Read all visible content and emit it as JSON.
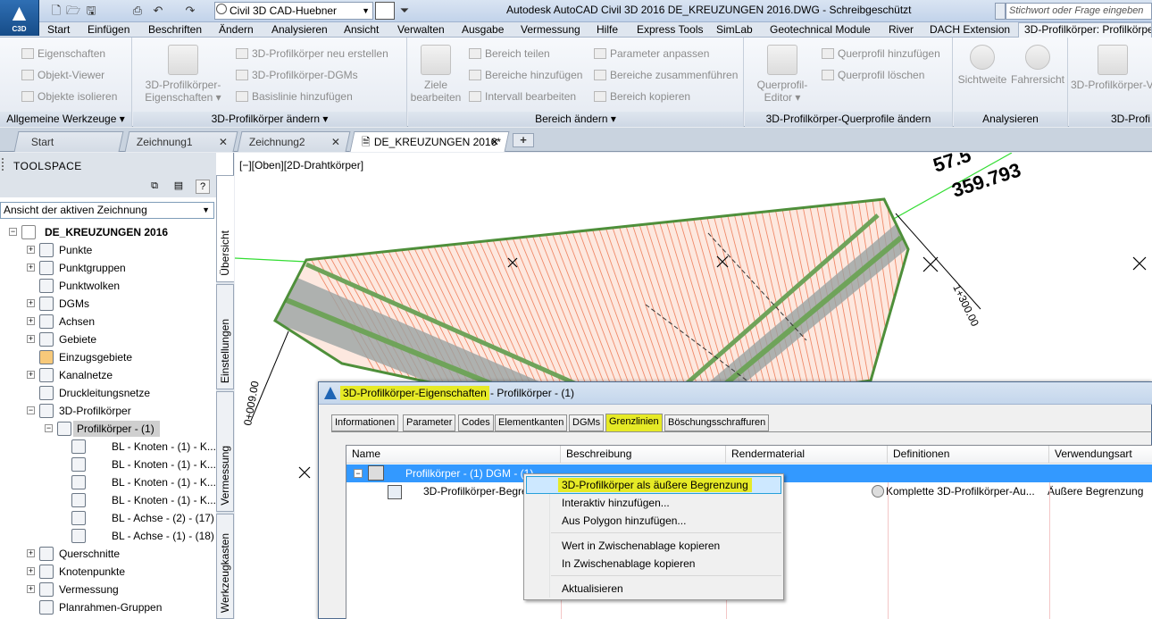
{
  "app": {
    "logo_text": "C3D",
    "workspace": "Civil 3D CAD-Huebner",
    "title": "Autodesk AutoCAD Civil 3D 2016   DE_KREUZUNGEN 2016.DWG - Schreibgeschützt",
    "search_placeholder": "Stichwort oder Frage eingeben"
  },
  "menu_tabs": [
    "Start",
    "Einfügen",
    "Beschriften",
    "Ändern",
    "Analysieren",
    "Ansicht",
    "Verwalten",
    "Ausgabe",
    "Vermessung",
    "Hilfe",
    "Express Tools",
    "SimLab",
    "Geotechnical Module",
    "River",
    "DACH Extension",
    "3D-Profilkörper: Profilkörper - (1)"
  ],
  "ribbon": {
    "panel1": {
      "title": "Allgemeine Werkzeuge",
      "items": [
        "Eigenschaften",
        "Objekt-Viewer",
        "Objekte isolieren"
      ]
    },
    "panel2": {
      "title": "3D-Profilkörper ändern",
      "big_line1": "3D-Profilkörper-",
      "big_line2": "Eigenschaften",
      "items": [
        "3D-Profilkörper neu erstellen",
        "3D-Profilkörper-DGMs",
        "Basislinie hinzufügen"
      ]
    },
    "panel3": {
      "title": "Bereich ändern",
      "big_line1": "Ziele",
      "big_line2": "bearbeiten",
      "items": [
        "Bereich teilen",
        "Bereiche hinzufügen",
        "Intervall bearbeiten",
        "Parameter anpassen",
        "Bereiche zusammenführen",
        "Bereich kopieren"
      ]
    },
    "panel4": {
      "title": "3D-Profilkörper-Querprofile ändern",
      "big_line1": "Querprofil-",
      "big_line2": "Editor",
      "items": [
        "Querprofil hinzufügen",
        "Querprofil löschen"
      ]
    },
    "panel5": {
      "title": "Analysieren",
      "big1": "Sichtweite",
      "big2": "Fahrersicht"
    },
    "panel6": {
      "title": "3D-Profi",
      "big1": "3D-Profilkörper-V"
    }
  },
  "doc_tabs": [
    "Start",
    "Zeichnung1",
    "Zeichnung2",
    "DE_KREUZUNGEN 2016*"
  ],
  "toolspace": {
    "title": "TOOLSPACE",
    "view_select": "Ansicht der aktiven Zeichnung",
    "drawing": "DE_KREUZUNGEN 2016",
    "tree": [
      "Punkte",
      "Punktgruppen",
      "Punktwolken",
      "DGMs",
      "Achsen",
      "Gebiete",
      "Einzugsgebiete",
      "Kanalnetze",
      "Druckleitungsnetze",
      "3D-Profilkörper"
    ],
    "corridor": "Profilkörper - (1)",
    "baselines": [
      "BL - Knoten - (1) - K...",
      "BL - Knoten - (1) - K...",
      "BL - Knoten - (1) - K...",
      "BL - Knoten - (1) - K...",
      "BL - Achse - (2) - (17)",
      "BL - Achse - (1) - (18)"
    ],
    "tree_after": [
      "Querschnitte",
      "Knotenpunkte",
      "Vermessung",
      "Planrahmen-Gruppen"
    ],
    "vtabs": [
      "Übersicht",
      "Einstellungen",
      "Vermessung",
      "Werkzeugkasten"
    ]
  },
  "viewport": {
    "label": "[−][Oben][2D-Drahtkörper]",
    "annotations": [
      "57.5",
      "359.793",
      "1+300.00",
      "0+009.00"
    ]
  },
  "dialog": {
    "title_hl": "3D-Profilkörper-Eigenschaften",
    "title_rest": " - Profilkörper - (1)",
    "tabs": [
      "Informationen",
      "Parameter",
      "Codes",
      "Elementkanten",
      "DGMs",
      "Grenzlinien",
      "Böschungsschraffuren"
    ],
    "columns": [
      "Name",
      "Beschreibung",
      "Rendermaterial",
      "Definitionen",
      "Verwendungsart"
    ],
    "row1_name": "Profilkörper - (1) DGM - (1)",
    "row2_name": "3D-Profilkörper-Begre",
    "row2_definition": "Komplette 3D-Profilkörper-Au...",
    "row2_usage": "Äußere Begrenzung"
  },
  "context_menu": [
    "3D-Profilkörper als äußere Begrenzung",
    "Interaktiv hinzufügen...",
    "Aus Polygon hinzufügen...",
    "Wert in Zwischenablage kopieren",
    "In Zwischenablage kopieren",
    "Aktualisieren"
  ],
  "colors": {
    "highlight": "#e6ea26",
    "selection": "#3399ff",
    "corridor_lines": "#f08a6a",
    "corridor_fill": "#9aa3a3",
    "corridor_edge": "#4e8f3a"
  }
}
